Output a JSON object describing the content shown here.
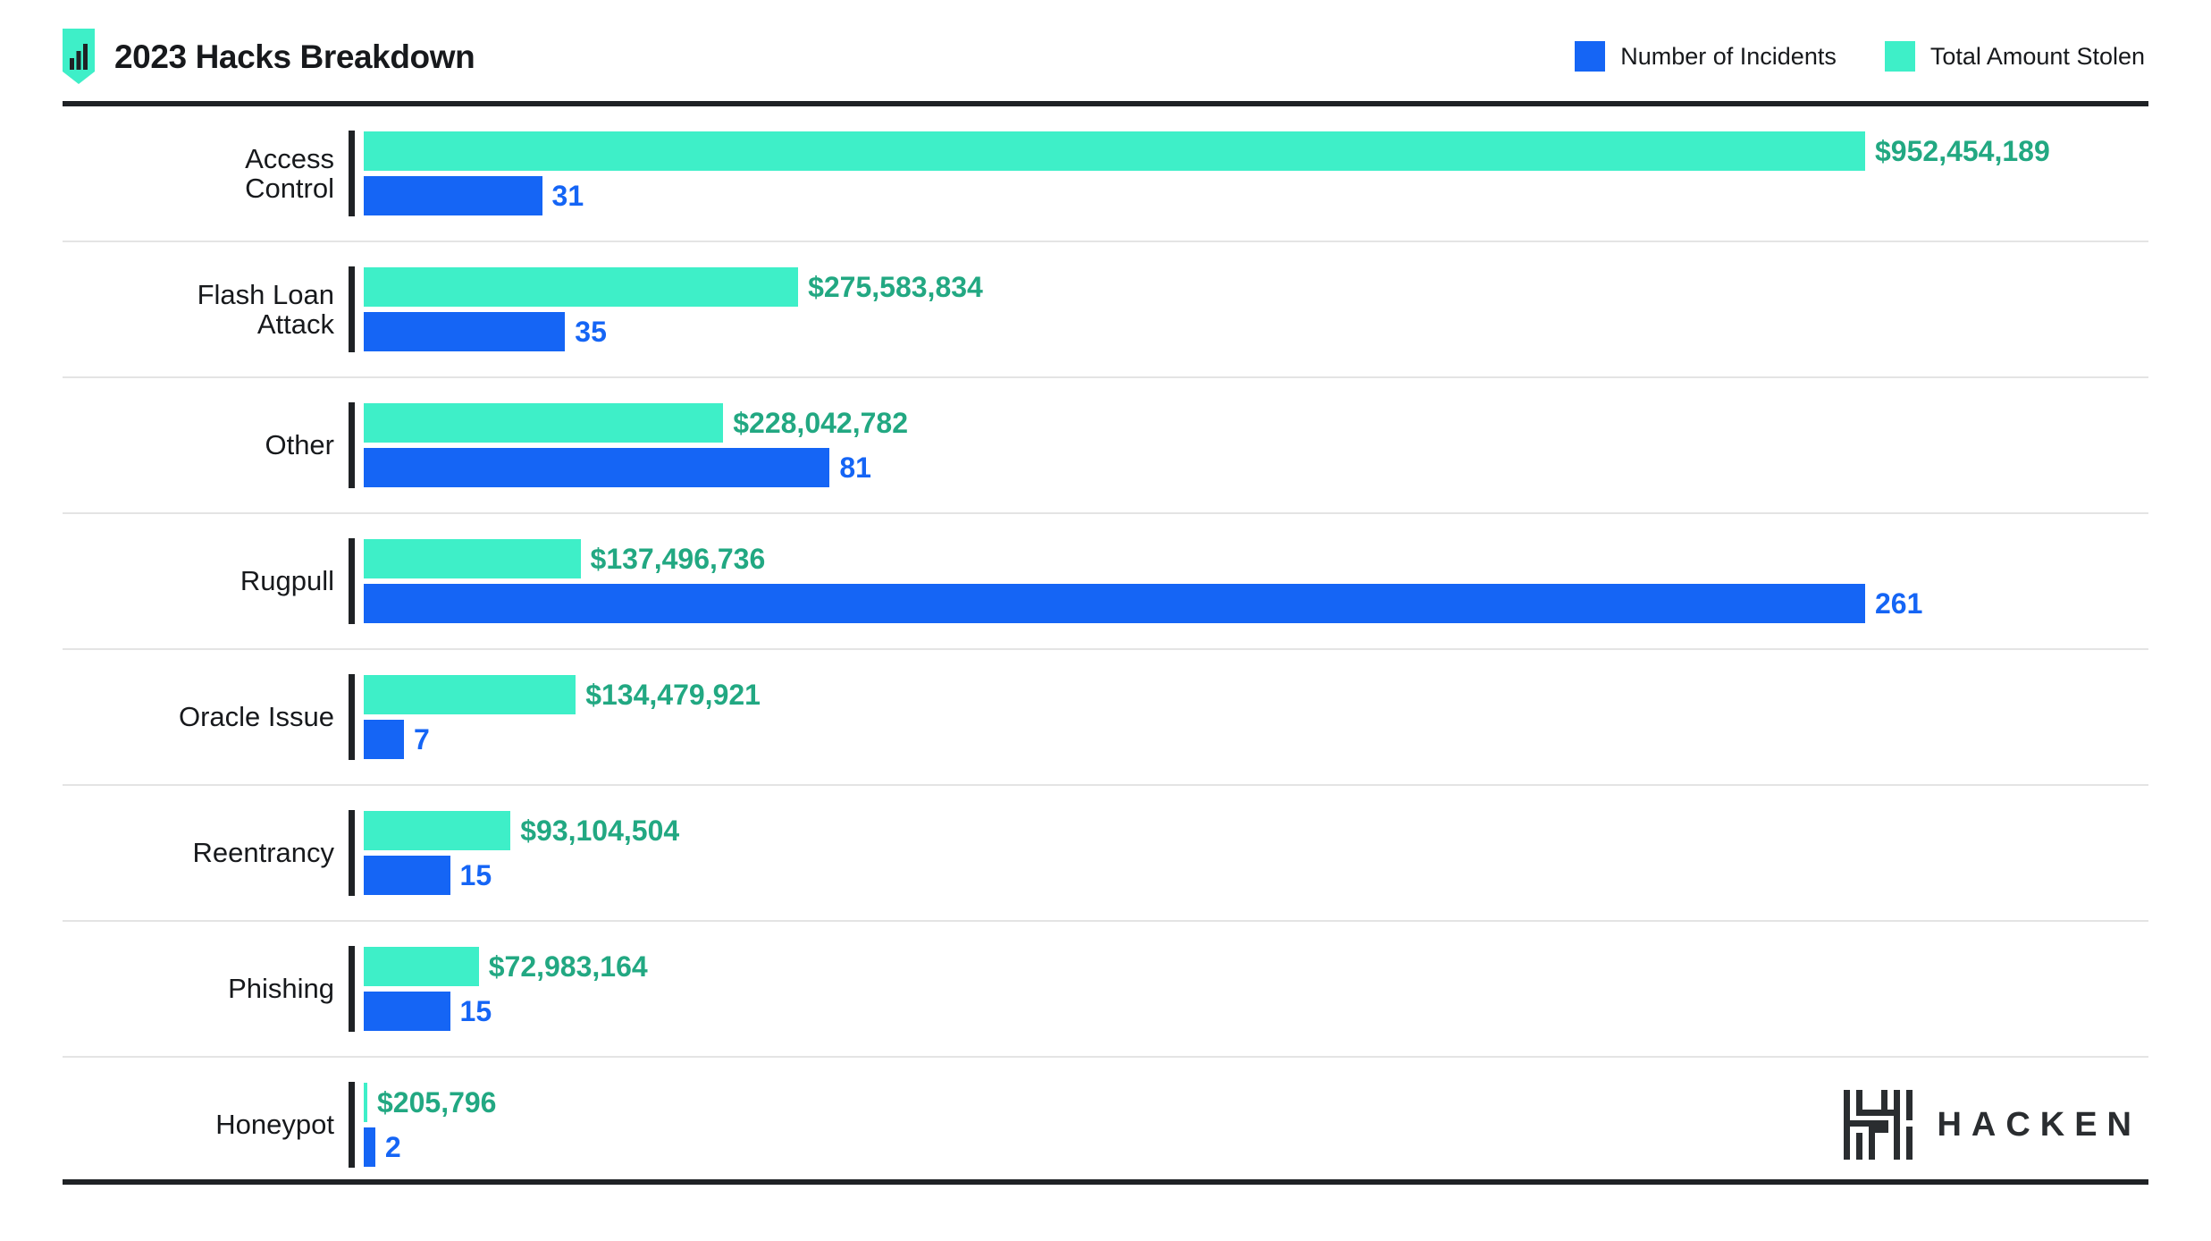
{
  "header": {
    "title": "2023 Hacks Breakdown",
    "badge_icon": "bar-chart-shield-icon",
    "badge_color": "#3EEFC8"
  },
  "legend": {
    "items": [
      {
        "label": "Number of Incidents",
        "color": "#1565F5",
        "icon": "legend-swatch-blue"
      },
      {
        "label": "Total Amount Stolen",
        "color": "#3EEFC8",
        "icon": "legend-swatch-teal"
      }
    ]
  },
  "footer": {
    "logo_text": "HACKEN",
    "logo_mark": "hacken-maze-h-icon"
  },
  "colors": {
    "bar_teal": "#3EEFC8",
    "bar_blue": "#1565F5",
    "label_teal": "#22A882",
    "label_blue": "#1565F5",
    "rule_dark": "#1F2225",
    "divider": "#E4E4E4",
    "text_dark": "#17191C",
    "background": "#FFFFFF"
  },
  "chart_data": {
    "type": "bar",
    "orientation": "horizontal",
    "title": "2023 Hacks Breakdown",
    "xlabel": "",
    "ylabel": "",
    "grid": false,
    "legend_position": "top-right",
    "categories": [
      "Access Control",
      "Flash Loan Attack",
      "Other",
      "Rugpull",
      "Oracle Issue",
      "Reentrancy",
      "Phishing",
      "Honeypot"
    ],
    "series": [
      {
        "name": "Total Amount Stolen",
        "color": "#3EEFC8",
        "values": [
          952454189,
          275583834,
          228042782,
          137496736,
          134479921,
          93104504,
          72983164,
          205796
        ],
        "labels": [
          "$952,454,189",
          "$275,583,834",
          "$228,042,782",
          "$137,496,736",
          "$134,479,921",
          "$93,104,504",
          "$72,983,164",
          "$205,796"
        ],
        "max": 952454189
      },
      {
        "name": "Number of Incidents",
        "color": "#1565F5",
        "values": [
          31,
          35,
          81,
          261,
          7,
          15,
          15,
          2
        ],
        "labels": [
          "31",
          "35",
          "81",
          "261",
          "7",
          "15",
          "15",
          "2"
        ],
        "max": 261
      }
    ]
  },
  "rows": [
    {
      "label": "Access\nControl",
      "amount_label": "$952,454,189",
      "amount_value": 952454189,
      "count_label": "31",
      "count_value": 31
    },
    {
      "label": "Flash Loan\nAttack",
      "amount_label": "$275,583,834",
      "amount_value": 275583834,
      "count_label": "35",
      "count_value": 35
    },
    {
      "label": "Other",
      "amount_label": "$228,042,782",
      "amount_value": 228042782,
      "count_label": "81",
      "count_value": 81
    },
    {
      "label": "Rugpull",
      "amount_label": "$137,496,736",
      "amount_value": 137496736,
      "count_label": "261",
      "count_value": 261
    },
    {
      "label": "Oracle Issue",
      "amount_label": "$134,479,921",
      "amount_value": 134479921,
      "count_label": "7",
      "count_value": 7
    },
    {
      "label": "Reentrancy",
      "amount_label": "$93,104,504",
      "amount_value": 93104504,
      "count_label": "15",
      "count_value": 15
    },
    {
      "label": "Phishing",
      "amount_label": "$72,983,164",
      "amount_value": 72983164,
      "count_label": "15",
      "count_value": 15
    },
    {
      "label": "Honeypot",
      "amount_label": "$205,796",
      "amount_value": 205796,
      "count_label": "2",
      "count_value": 2
    }
  ]
}
